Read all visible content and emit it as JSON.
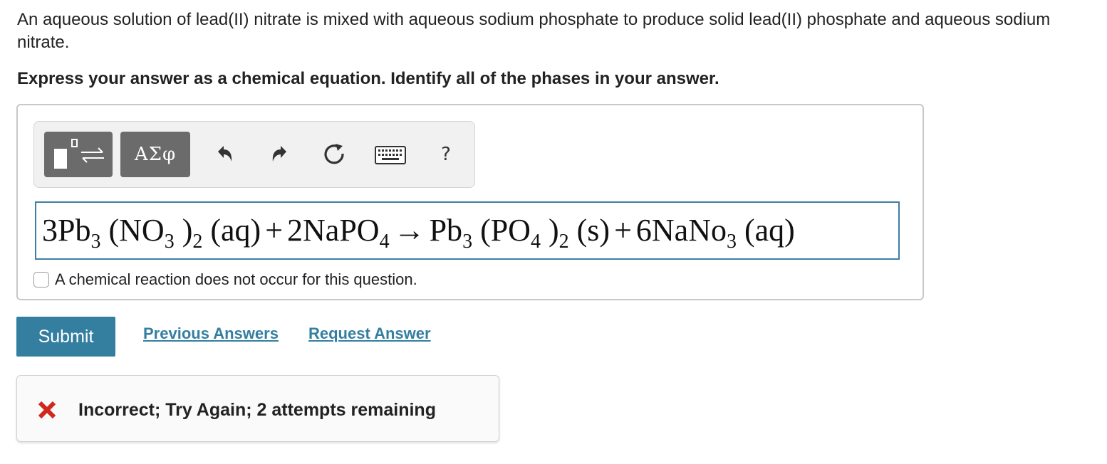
{
  "question": {
    "text": "An aqueous solution of lead(II) nitrate is mixed with aqueous sodium phosphate to produce solid lead(II) phosphate and aqueous sodium nitrate.",
    "instruction": "Express your answer as a chemical equation. Identify all of the phases in your answer."
  },
  "toolbar": {
    "templates_icon": "templates-icon",
    "symbols_label": "ΑΣφ",
    "undo_icon": "undo-icon",
    "redo_icon": "redo-icon",
    "reset_icon": "reset-icon",
    "keyboard_icon": "keyboard-icon",
    "help_label": "?"
  },
  "equation": {
    "t1_coef": "3Pb",
    "t1_sub1": "3",
    "t1_mid": " (NO",
    "t1_sub2": "3",
    "t1_close": " )",
    "t1_sub3": "2",
    "t1_phase": " (aq)",
    "plus1": "+",
    "t2_formula": "2NaPO",
    "t2_sub": "4",
    "arrow": "→",
    "p1_formula": "Pb",
    "p1_sub1": "3",
    "p1_mid": " (PO",
    "p1_sub2": "4",
    "p1_close": " )",
    "p1_sub3": "2",
    "p1_phase": " (s)",
    "plus2": "+",
    "p2_formula": "6NaNo",
    "p2_sub": "3",
    "p2_phase": " (aq)"
  },
  "no_reaction": {
    "checked": false,
    "label": "A chemical reaction does not occur for this question."
  },
  "actions": {
    "submit_label": "Submit",
    "previous_answers_label": "Previous Answers",
    "request_answer_label": "Request Answer"
  },
  "feedback": {
    "icon": "x-icon",
    "text": "Incorrect; Try Again; 2 attempts remaining",
    "icon_color": "#d0281d"
  },
  "colors": {
    "accent": "#347fa0",
    "field_border": "#3d7fa5",
    "toolbar_button": "#6b6b6b",
    "error": "#d0281d"
  }
}
